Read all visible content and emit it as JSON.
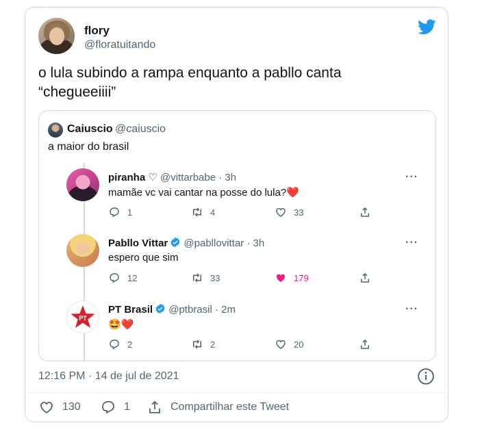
{
  "tweet": {
    "display_name": "flory",
    "handle": "@floratuitando",
    "text_line1": "o lula subindo a rampa enquanto a pabllo canta",
    "text_line2": "“chegueeiiii”",
    "timestamp": "12:16 PM · 14 de jul de 2021"
  },
  "quote": {
    "display_name": "Caiuscio",
    "handle": "@caiuscio",
    "text": "a maior do brasil"
  },
  "replies": [
    {
      "name": "piranha ♡",
      "handle": "@vittarbabe · 3h",
      "text": "mamãe vc vai cantar na posse do lula?❤️",
      "replies": "1",
      "retweets": "4",
      "likes": "33",
      "liked": false,
      "verified": false
    },
    {
      "name": "Pabllo Vittar",
      "handle": "@pabllovittar · 3h",
      "text": "espero que sim",
      "replies": "12",
      "retweets": "33",
      "likes": "179",
      "liked": true,
      "verified": true
    },
    {
      "name": "PT Brasil",
      "handle": "@ptbrasil · 2m",
      "text": "🤩❤️",
      "replies": "2",
      "retweets": "2",
      "likes": "20",
      "liked": false,
      "verified": true
    }
  ],
  "pt_logo_text": "PT",
  "more_label": "···",
  "footer": {
    "likes": "130",
    "replies": "1",
    "share_label": "Compartilhar este Tweet"
  },
  "colors": {
    "brand": "#1d9bf0",
    "like": "#f91880",
    "muted": "#536471",
    "border": "#cfd9de"
  },
  "icons": [
    "twitter-bird-icon",
    "verified-icon",
    "reply-icon",
    "retweet-icon",
    "heart-icon",
    "share-icon",
    "info-icon",
    "more-icon"
  ]
}
